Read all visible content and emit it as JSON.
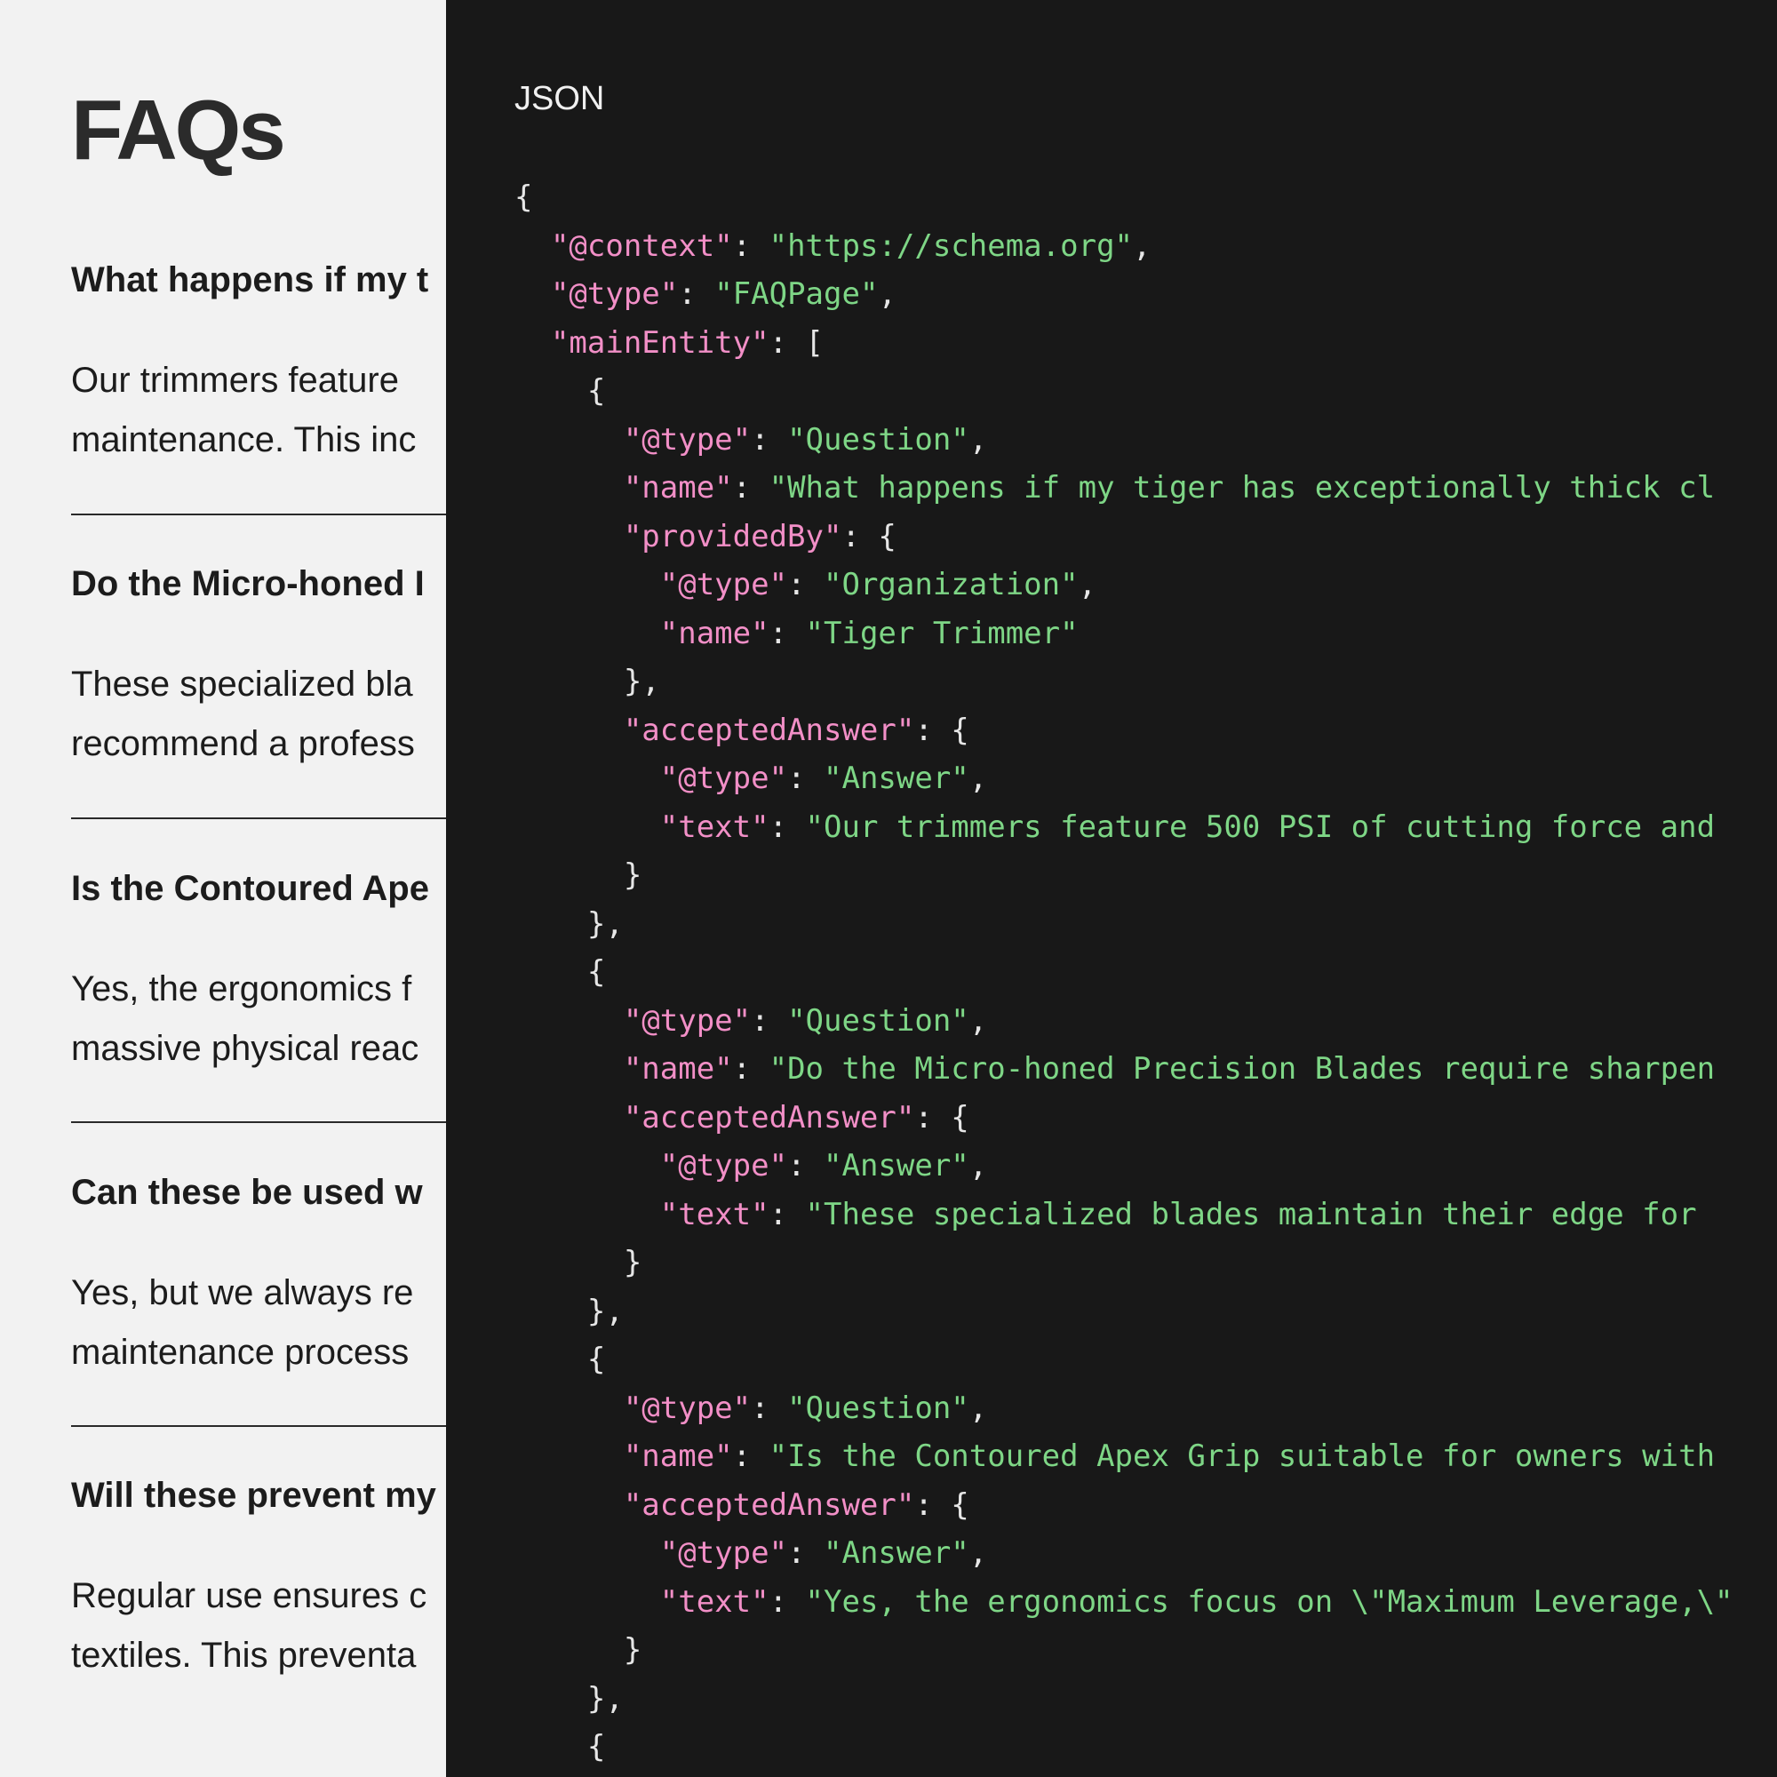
{
  "faq": {
    "title": "FAQs",
    "items": [
      {
        "question": "What happens if my t",
        "answer_lines": [
          "Our trimmers feature",
          "maintenance. This inc"
        ]
      },
      {
        "question": "Do the Micro-honed I",
        "answer_lines": [
          "These specialized bla",
          "recommend a profess"
        ]
      },
      {
        "question": "Is the Contoured Ape",
        "answer_lines": [
          "Yes, the ergonomics f",
          "massive physical reac"
        ]
      },
      {
        "question": "Can these be used w",
        "answer_lines": [
          "Yes, but we always re",
          "maintenance process"
        ]
      },
      {
        "question": "Will these prevent my",
        "answer_lines": [
          "Regular use ensures c",
          "textiles. This preventa"
        ]
      }
    ]
  },
  "code_panel": {
    "label": "JSON",
    "lines": [
      [
        [
          "p",
          "{"
        ]
      ],
      [
        [
          "p",
          "  "
        ],
        [
          "k",
          "\"@context\""
        ],
        [
          "p",
          ": "
        ],
        [
          "s",
          "\"https://schema.org\""
        ],
        [
          "p",
          ","
        ]
      ],
      [
        [
          "p",
          "  "
        ],
        [
          "k",
          "\"@type\""
        ],
        [
          "p",
          ": "
        ],
        [
          "s",
          "\"FAQPage\""
        ],
        [
          "p",
          ","
        ]
      ],
      [
        [
          "p",
          "  "
        ],
        [
          "k",
          "\"mainEntity\""
        ],
        [
          "p",
          ": ["
        ]
      ],
      [
        [
          "p",
          "    {"
        ]
      ],
      [
        [
          "p",
          "      "
        ],
        [
          "k",
          "\"@type\""
        ],
        [
          "p",
          ": "
        ],
        [
          "s",
          "\"Question\""
        ],
        [
          "p",
          ","
        ]
      ],
      [
        [
          "p",
          "      "
        ],
        [
          "k",
          "\"name\""
        ],
        [
          "p",
          ": "
        ],
        [
          "s",
          "\"What happens if my tiger has exceptionally thick cl"
        ]
      ],
      [
        [
          "p",
          "      "
        ],
        [
          "k",
          "\"providedBy\""
        ],
        [
          "p",
          ": {"
        ]
      ],
      [
        [
          "p",
          "        "
        ],
        [
          "k",
          "\"@type\""
        ],
        [
          "p",
          ": "
        ],
        [
          "s",
          "\"Organization\""
        ],
        [
          "p",
          ","
        ]
      ],
      [
        [
          "p",
          "        "
        ],
        [
          "k",
          "\"name\""
        ],
        [
          "p",
          ": "
        ],
        [
          "s",
          "\"Tiger Trimmer\""
        ]
      ],
      [
        [
          "p",
          "      },"
        ]
      ],
      [
        [
          "p",
          "      "
        ],
        [
          "k",
          "\"acceptedAnswer\""
        ],
        [
          "p",
          ": {"
        ]
      ],
      [
        [
          "p",
          "        "
        ],
        [
          "k",
          "\"@type\""
        ],
        [
          "p",
          ": "
        ],
        [
          "s",
          "\"Answer\""
        ],
        [
          "p",
          ","
        ]
      ],
      [
        [
          "p",
          "        "
        ],
        [
          "k",
          "\"text\""
        ],
        [
          "p",
          ": "
        ],
        [
          "s",
          "\"Our trimmers feature 500 PSI of cutting force and"
        ]
      ],
      [
        [
          "p",
          "      }"
        ]
      ],
      [
        [
          "p",
          "    },"
        ]
      ],
      [
        [
          "p",
          "    {"
        ]
      ],
      [
        [
          "p",
          "      "
        ],
        [
          "k",
          "\"@type\""
        ],
        [
          "p",
          ": "
        ],
        [
          "s",
          "\"Question\""
        ],
        [
          "p",
          ","
        ]
      ],
      [
        [
          "p",
          "      "
        ],
        [
          "k",
          "\"name\""
        ],
        [
          "p",
          ": "
        ],
        [
          "s",
          "\"Do the Micro-honed Precision Blades require sharpen"
        ]
      ],
      [
        [
          "p",
          "      "
        ],
        [
          "k",
          "\"acceptedAnswer\""
        ],
        [
          "p",
          ": {"
        ]
      ],
      [
        [
          "p",
          "        "
        ],
        [
          "k",
          "\"@type\""
        ],
        [
          "p",
          ": "
        ],
        [
          "s",
          "\"Answer\""
        ],
        [
          "p",
          ","
        ]
      ],
      [
        [
          "p",
          "        "
        ],
        [
          "k",
          "\"text\""
        ],
        [
          "p",
          ": "
        ],
        [
          "s",
          "\"These specialized blades maintain their edge for"
        ]
      ],
      [
        [
          "p",
          "      }"
        ]
      ],
      [
        [
          "p",
          "    },"
        ]
      ],
      [
        [
          "p",
          "    {"
        ]
      ],
      [
        [
          "p",
          "      "
        ],
        [
          "k",
          "\"@type\""
        ],
        [
          "p",
          ": "
        ],
        [
          "s",
          "\"Question\""
        ],
        [
          "p",
          ","
        ]
      ],
      [
        [
          "p",
          "      "
        ],
        [
          "k",
          "\"name\""
        ],
        [
          "p",
          ": "
        ],
        [
          "s",
          "\"Is the Contoured Apex Grip suitable for owners with"
        ]
      ],
      [
        [
          "p",
          "      "
        ],
        [
          "k",
          "\"acceptedAnswer\""
        ],
        [
          "p",
          ": {"
        ]
      ],
      [
        [
          "p",
          "        "
        ],
        [
          "k",
          "\"@type\""
        ],
        [
          "p",
          ": "
        ],
        [
          "s",
          "\"Answer\""
        ],
        [
          "p",
          ","
        ]
      ],
      [
        [
          "p",
          "        "
        ],
        [
          "k",
          "\"text\""
        ],
        [
          "p",
          ": "
        ],
        [
          "s",
          "\"Yes, the ergonomics focus on \\\"Maximum Leverage,\\\""
        ]
      ],
      [
        [
          "p",
          "      }"
        ]
      ],
      [
        [
          "p",
          "    },"
        ]
      ],
      [
        [
          "p",
          "    {"
        ]
      ]
    ]
  },
  "colors": {
    "page_bg": "#f2f2f2",
    "panel_bg": "#181818",
    "json_key": "#f28fc7",
    "json_string": "#7ed686",
    "json_punct": "#e6e6e6"
  }
}
